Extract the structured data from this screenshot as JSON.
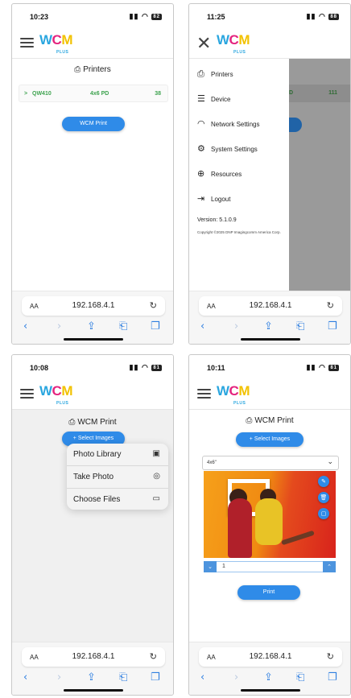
{
  "brand": {
    "logo_w": "W",
    "logo_c": "C",
    "logo_m": "M",
    "logo_sub": "PLUS"
  },
  "browser": {
    "aa": "AA",
    "url": "192.168.4.1"
  },
  "screens": [
    {
      "time": "10:23",
      "battery": "82",
      "title": "Printers",
      "printer": {
        "chevron": ">",
        "name": "QW410",
        "media": "4x6 PD",
        "count": "38"
      },
      "action_button": "WCM Print"
    },
    {
      "time": "11:25",
      "battery": "88",
      "behind_row": {
        "media_tail": "D",
        "count": "111"
      },
      "menu": [
        {
          "icon": "printer-icon",
          "label": "Printers"
        },
        {
          "icon": "device-icon",
          "label": "Device"
        },
        {
          "icon": "wifi-icon",
          "label": "Network Settings"
        },
        {
          "icon": "gear-icon",
          "label": "System Settings"
        },
        {
          "icon": "globe-icon",
          "label": "Resources"
        },
        {
          "icon": "logout-icon",
          "label": "Logout"
        }
      ],
      "version": "Version: 5.1.0.9",
      "copyright": "Copyright ©2025 DNP Imagingcomm America Corp."
    },
    {
      "time": "10:08",
      "battery": "81",
      "title": "WCM Print",
      "select_button": "+ Select Images",
      "popup": [
        {
          "label": "Photo Library",
          "icon": "photo-library-icon"
        },
        {
          "label": "Take Photo",
          "icon": "camera-icon"
        },
        {
          "label": "Choose Files",
          "icon": "folder-icon"
        }
      ]
    },
    {
      "time": "10:11",
      "battery": "81",
      "title": "WCM Print",
      "select_button": "+ Select Images",
      "size_option": "4x6\"",
      "quantity": "1",
      "print_button": "Print"
    }
  ]
}
